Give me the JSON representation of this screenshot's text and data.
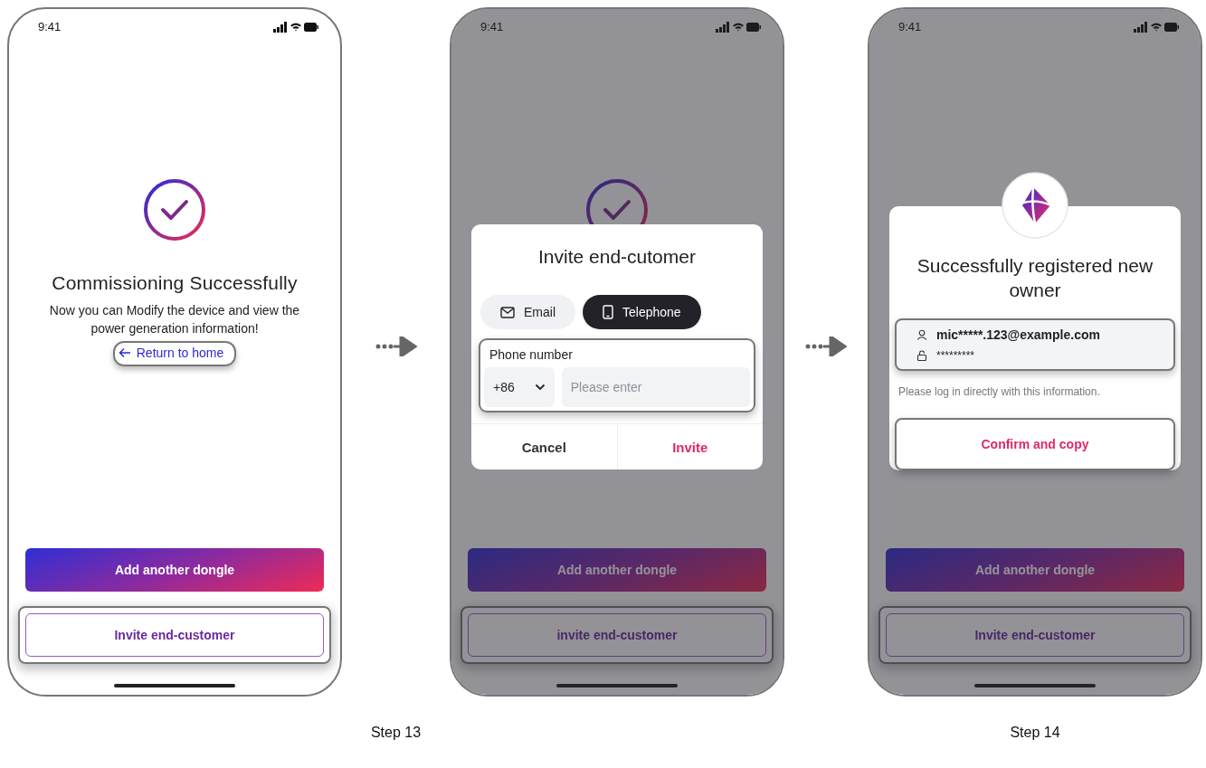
{
  "phones": [
    {
      "time": "9:41",
      "dimmed": false,
      "check_icon": true,
      "title": "Commissioning Successfully",
      "message": "Now you can Modify the device and view the power generation information!",
      "link": {
        "label": "Return to home",
        "highlighted": true
      },
      "buttons": [
        {
          "label": "Add another dongle",
          "kind": "primary",
          "highlighted": false
        },
        {
          "label": "Invite end-customer",
          "kind": "secondary",
          "highlighted": true
        }
      ]
    },
    {
      "time": "9:41",
      "dimmed": true,
      "check_icon": true,
      "buttons": [
        {
          "label": "Add another dongle",
          "kind": "primary",
          "highlighted": false
        },
        {
          "label": "invite end-customer",
          "kind": "secondary",
          "highlighted": true
        }
      ],
      "dialog": {
        "kind": "invite",
        "title": "Invite end-cutomer",
        "tabs": [
          {
            "label": "Email",
            "selected": false
          },
          {
            "label": "Telephone",
            "selected": true
          }
        ],
        "field": {
          "label": "Phone number",
          "country_code": "+86",
          "placeholder": "Please enter",
          "highlighted": true
        },
        "actions": [
          {
            "label": "Cancel",
            "kind": "cancel"
          },
          {
            "label": "Invite",
            "kind": "confirm"
          }
        ]
      }
    },
    {
      "time": "9:41",
      "dimmed": true,
      "check_icon": false,
      "buttons": [
        {
          "label": "Add another dongle",
          "kind": "primary",
          "highlighted": false
        },
        {
          "label": "Invite end-customer",
          "kind": "secondary",
          "highlighted": true
        }
      ],
      "dialog": {
        "kind": "registered",
        "title": "Successfully registered new owner",
        "username": "mic*****.123@example.com",
        "password": "*********",
        "credentials_highlighted": true,
        "note": "Please log in directly with this information.",
        "action": {
          "label": "Confirm and copy",
          "highlighted": true
        }
      }
    }
  ],
  "steps": [
    {
      "label": "Step 13"
    },
    {
      "label": "Step 14"
    }
  ]
}
